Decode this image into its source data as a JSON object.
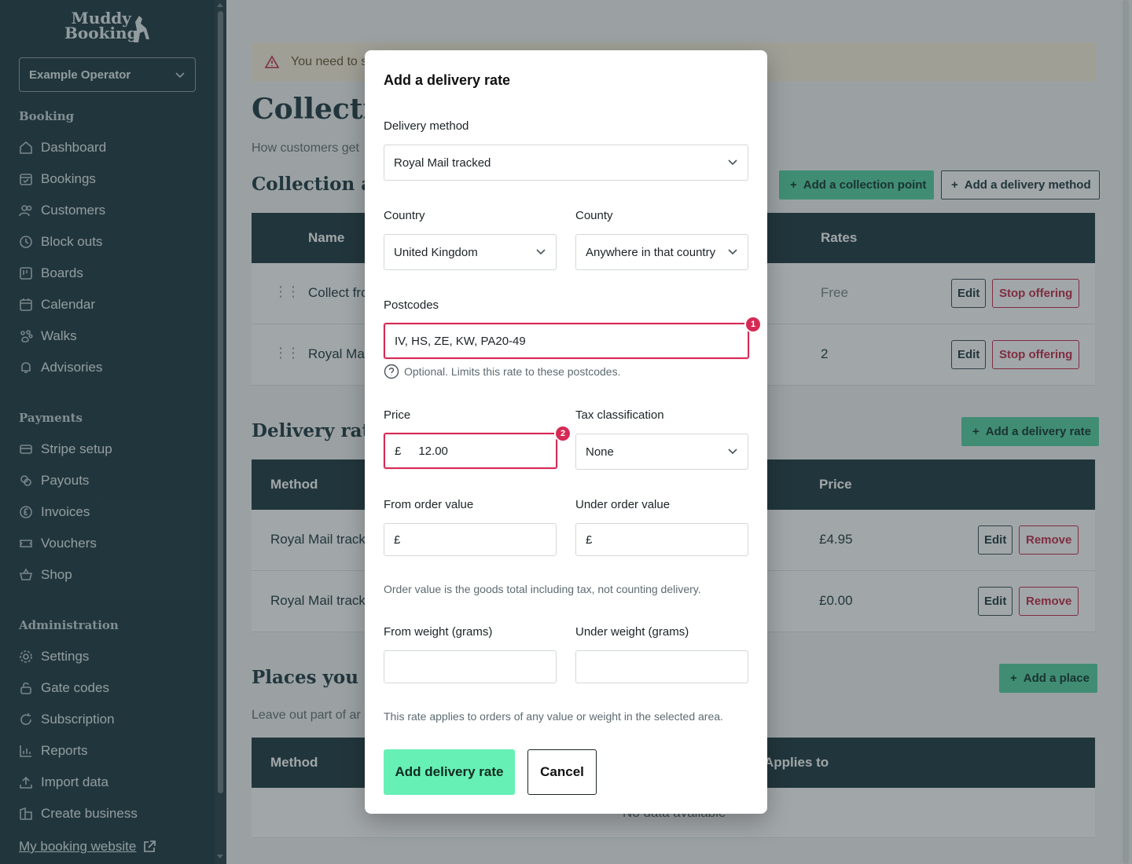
{
  "sidebar": {
    "logo_line1": "Muddy",
    "logo_line2": "Booking",
    "operator": "Example Operator",
    "sections": {
      "booking": "Booking",
      "payments": "Payments",
      "administration": "Administration"
    },
    "booking_items": [
      {
        "label": "Dashboard",
        "icon": "home-icon"
      },
      {
        "label": "Bookings",
        "icon": "calendar-check-icon"
      },
      {
        "label": "Customers",
        "icon": "users-icon"
      },
      {
        "label": "Block outs",
        "icon": "clock-icon"
      },
      {
        "label": "Boards",
        "icon": "board-icon"
      },
      {
        "label": "Calendar",
        "icon": "calendar-icon"
      },
      {
        "label": "Walks",
        "icon": "paw-icon"
      },
      {
        "label": "Advisories",
        "icon": "bell-icon"
      }
    ],
    "payments_items": [
      {
        "label": "Stripe setup",
        "icon": "cards-icon"
      },
      {
        "label": "Payouts",
        "icon": "coins-icon"
      },
      {
        "label": "Invoices",
        "icon": "pound-icon"
      },
      {
        "label": "Vouchers",
        "icon": "ticket-icon"
      },
      {
        "label": "Shop",
        "icon": "basket-icon"
      }
    ],
    "admin_items": [
      {
        "label": "Settings",
        "icon": "gear-icon"
      },
      {
        "label": "Gate codes",
        "icon": "lock-icon"
      },
      {
        "label": "Subscription",
        "icon": "refresh-icon"
      },
      {
        "label": "Reports",
        "icon": "chart-icon"
      },
      {
        "label": "Import data",
        "icon": "upload-icon"
      },
      {
        "label": "Create business",
        "icon": "building-icon"
      }
    ],
    "site_link": "My booking website"
  },
  "main": {
    "warning": "You need to s",
    "title": "Collecti",
    "subtitle": "How customers get",
    "collection_heading": "Collection a",
    "add_collection_point": "Add a collection point",
    "add_delivery_method": "Add a delivery method",
    "collection_table": {
      "headers": [
        "Name",
        "Rates"
      ],
      "rows": [
        {
          "name": "Collect fro",
          "rates": "Free"
        },
        {
          "name": "Royal Mai",
          "rates": "2"
        }
      ]
    },
    "edit_label": "Edit",
    "stop_label": "Stop offering",
    "delivery_heading": "Delivery rat",
    "add_delivery_rate": "Add a delivery rate",
    "delivery_table": {
      "headers": [
        "Method",
        "Price"
      ],
      "rows": [
        {
          "method": "Royal Mail tracke",
          "price": "£4.95"
        },
        {
          "method": "Royal Mail tracke",
          "price": "£0.00"
        }
      ]
    },
    "remove_label": "Remove",
    "places_heading": "Places you d",
    "add_place": "Add a place",
    "places_subtitle": "Leave out part of ar",
    "places_table": {
      "headers": [
        "Method",
        "Applies to"
      ],
      "empty": "No data available"
    }
  },
  "modal": {
    "title": "Add a delivery rate",
    "delivery_method_label": "Delivery method",
    "delivery_method_value": "Royal Mail tracked",
    "country_label": "Country",
    "country_value": "United Kingdom",
    "county_label": "County",
    "county_value": "Anywhere in that country",
    "postcodes_label": "Postcodes",
    "postcodes_value": "IV, HS, ZE, KW, PA20-49",
    "postcodes_hint": "Optional. Limits this rate to these postcodes.",
    "badge1": "1",
    "price_label": "Price",
    "currency_symbol": "£",
    "price_value": "12.00",
    "badge2": "2",
    "tax_label": "Tax classification",
    "tax_value": "None",
    "from_order_label": "From order value",
    "under_order_label": "Under order value",
    "from_order_value": "",
    "under_order_value": "",
    "order_hint": "Order value is the goods total including tax, not counting delivery.",
    "from_weight_label": "From weight (grams)",
    "under_weight_label": "Under weight (grams)",
    "from_weight_value": "",
    "under_weight_value": "",
    "applies_hint": "This rate applies to orders of any value or weight in the selected area.",
    "submit_label": "Add delivery rate",
    "cancel_label": "Cancel"
  },
  "colors": {
    "sidebar_bg": "#233e46",
    "primary": "#66f0b5",
    "error": "#d62a55",
    "danger": "#c4304f"
  }
}
